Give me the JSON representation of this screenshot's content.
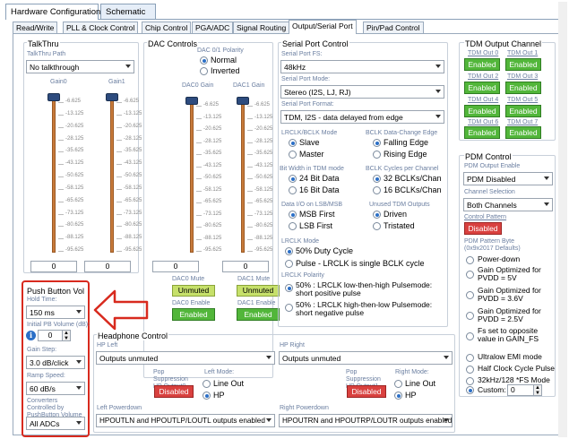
{
  "tabs": {
    "hw": "Hardware Configuration",
    "schematic": "Schematic"
  },
  "subtabs": [
    "Read/Write",
    "PLL & Clock Control",
    "Chip Control",
    "PGA/ADC",
    "Signal Routing",
    "Output/Serial Port",
    "Pin/Pad Control"
  ],
  "talkthru": {
    "title": "TalkThru",
    "path_label": "TalkThru Path",
    "path_value": "No talkthrough",
    "gain0": "Gain0",
    "gain1": "Gain1",
    "gain0_value": "0",
    "gain1_value": "0",
    "gain0_level": 1.0,
    "gain1_level": 1.0
  },
  "dac": {
    "title": "DAC Controls",
    "polarity_label": "DAC 0/1 Polarity",
    "normal": "Normal",
    "inverted": "Inverted",
    "gain0": "DAC0 Gain",
    "gain1": "DAC1 Gain",
    "gain0_value": "0",
    "gain1_value": "0",
    "gain0_level": 1.0,
    "gain1_level": 1.0,
    "mute0_label": "DAC0 Mute",
    "mute1_label": "DAC1 Mute",
    "mute0": "Unmuted",
    "mute1": "Unmuted",
    "enable0_label": "DAC0 Enable",
    "enable1_label": "DAC1 Enable",
    "enable0": "Enabled",
    "enable1": "Enabled"
  },
  "ticks": [
    "-6.625",
    "-13.125",
    "-20.625",
    "-28.125",
    "-35.625",
    "-43.125",
    "-50.625",
    "-58.125",
    "-65.625",
    "-73.125",
    "-80.625",
    "-88.125",
    "-95.625"
  ],
  "serial": {
    "title": "Serial Port Control",
    "fs_label": "Serial Port FS:",
    "fs_value": "48kHz",
    "mode_label": "Serial Port Mode:",
    "mode_value": "Stereo (I2S, LJ, RJ)",
    "format_label": "Serial Port Format:",
    "format_value": "TDM, I2S - data delayed from edge",
    "lrclk_mode_label": "LRCLK/BCLK Mode",
    "slave": "Slave",
    "master": "Master",
    "bclk_edge_label": "BCLK Data-Change Edge",
    "falling": "Falling Edge",
    "rising": "Rising Edge",
    "bitwidth_label": "Bit Width in TDM mode",
    "bit24": "24 Bit Data",
    "bit16": "16 Bit Data",
    "bclk_cycles_label": "BCLK Cycles per Channel",
    "bclk32": "32 BCLKs/Chan",
    "bclk16": "16 BCLKs/Chan",
    "dataio_label": "Data I/O on LSB/MSB",
    "msb": "MSB First",
    "lsb": "LSB First",
    "unused_label": "Unused TDM Outputs",
    "driven": "Driven",
    "tristated": "Tristated",
    "lrclk_label": "LRCLK Mode",
    "duty50": "50% Duty Cycle",
    "pulse": "Pulse - LRCLK is single BCLK cycle",
    "polarity_label": "LRCLK Polarity",
    "pol1": "50% : LRCLK  low-then-high Pulsemode: short positive pulse",
    "pol2": "50% : LRCLK  high-then-low Pulsemode: short negative pulse"
  },
  "tdm": {
    "title": "TDM Output Channel",
    "out0": "TDM Out 0",
    "out1": "TDM Out 1",
    "out2": "TDM Out 2",
    "out3": "TDM Out 3",
    "out4": "TDM Out 4",
    "out5": "TDM Out 5",
    "out6": "TDM Out 6",
    "out7": "TDM Out 7",
    "enabled": "Enabled"
  },
  "pdm": {
    "title": "PDM Control",
    "enable_label": "PDM Output Enable",
    "enable_value": "PDM Disabled",
    "chsel_label": "Channel Selection",
    "chsel_value": "Both Channels",
    "pattern_label": "Control Pattern",
    "pattern_value": "Disabled",
    "byte_label": "PDM Pattern Byte",
    "byte_default": "(0x9x2017 Defaults)",
    "opt1": "Power-down",
    "opt2": "Gain Optimized for PVDD = 5V",
    "opt3": "Gain Optimized for PVDD = 3.6V",
    "opt4": "Gain Optimized for PVDD = 2.5V",
    "opt5": "Fs set to opposite value in GAIN_FS",
    "opt6": "Ultralow EMI mode",
    "opt7": "Half Clock Cycle Pulse",
    "opt8": "32kHz/128 *FS Mode",
    "custom": "Custom:",
    "custom_value": "0"
  },
  "pushbutton": {
    "title": "Push Button Vol",
    "hold_label": "Hold Time:",
    "hold_value": "150 ms",
    "initial_label": "Initial PB Volume (dB):",
    "initial_value": "0",
    "step_label": "Gain Step:",
    "step_value": "3.0 dB/click",
    "ramp_label": "Ramp Speed:",
    "ramp_value": "60 dB/s",
    "conv_label": "Converters Controlled by PushButton Volume",
    "conv_value": "All ADCs"
  },
  "headphone": {
    "title": "Headphone Control",
    "left_label": "HP Left",
    "left_value": "Outputs unmuted",
    "right_label": "HP Right",
    "right_value": "Outputs unmuted",
    "popl_label": "Pop Suppression HP Output0",
    "popr_label": "Pop Suppression HP Output1",
    "popl_value": "Disabled",
    "popr_value": "Disabled",
    "lmode_label": "Left Mode:",
    "rmode_label": "Right Mode:",
    "lineout": "Line Out",
    "hp": "HP",
    "lpd_label": "Left Powerdown",
    "rpd_label": "Right Powerdown",
    "lpd_value": "HPOUTLN and HPOUTLP/LOUTL outputs enabled",
    "rpd_value": "HPOUTRN and HPOUTRP/LOUTR outputs enabled"
  },
  "colors": {
    "highlight": "#d82a1e",
    "green": "#52b63a",
    "red": "#d9413f"
  }
}
